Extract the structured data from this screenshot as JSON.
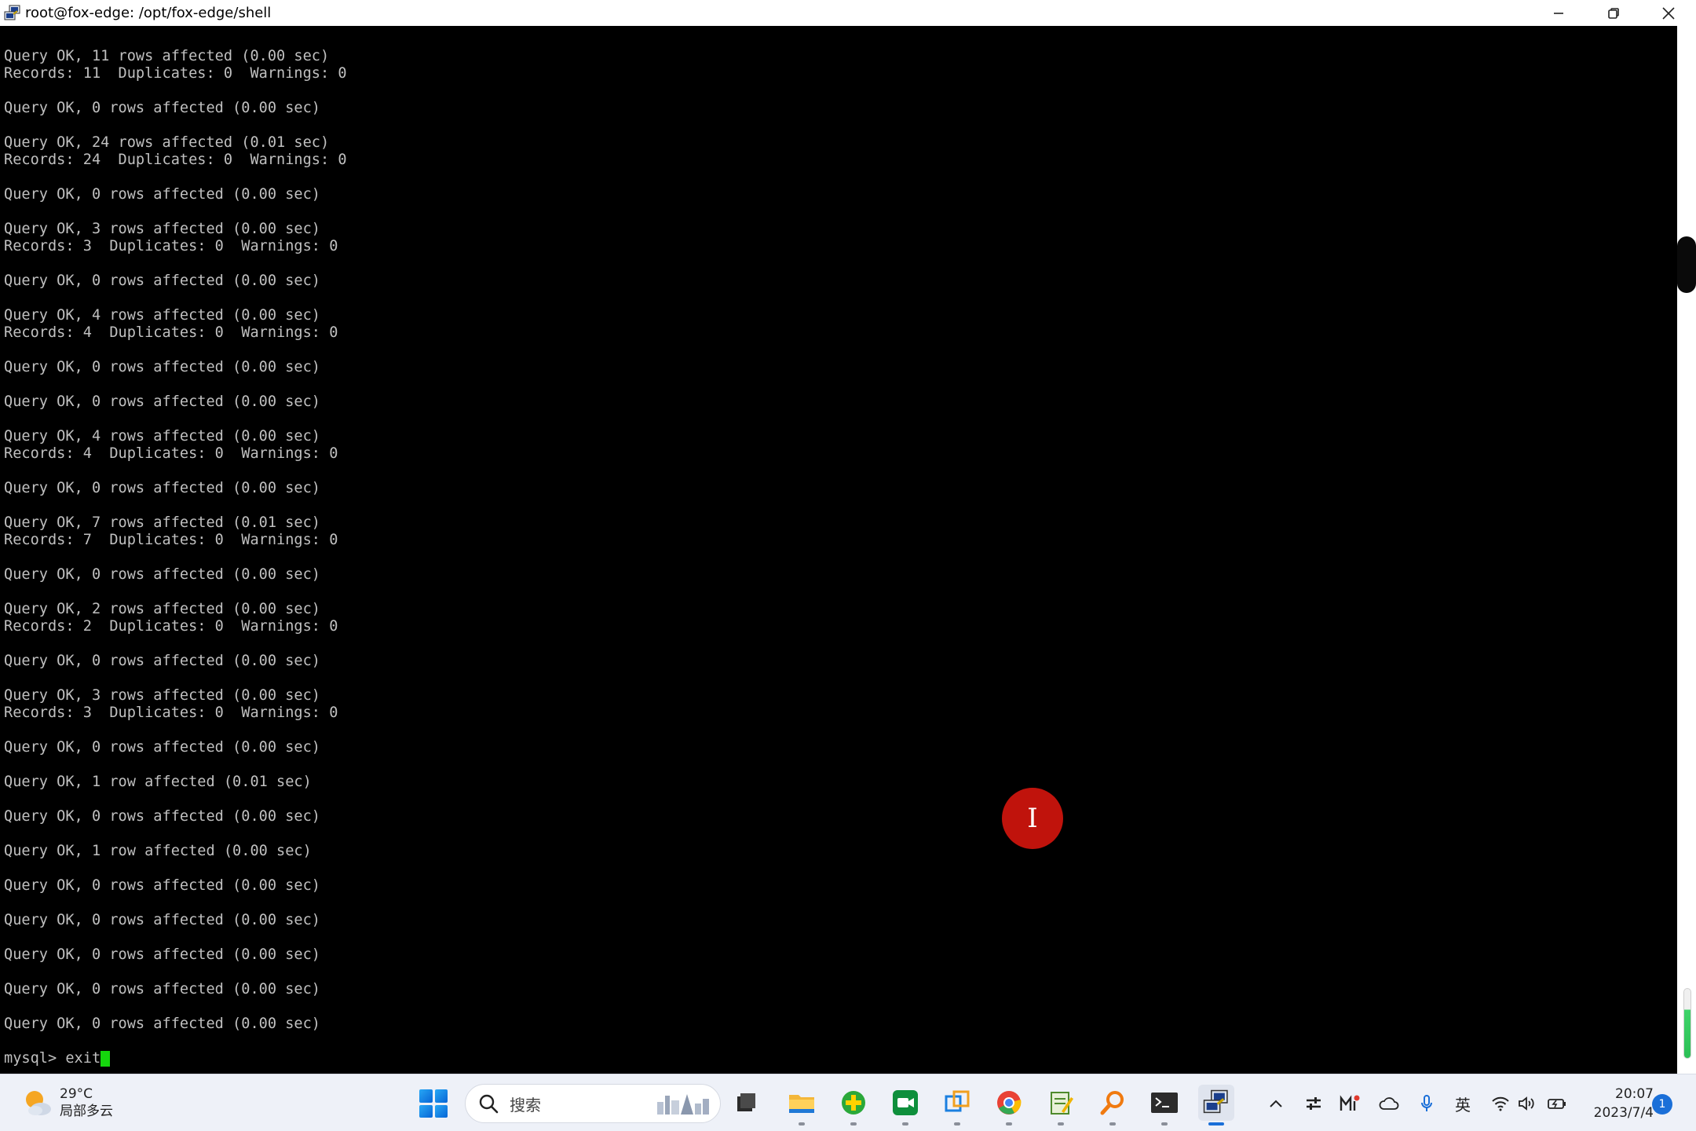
{
  "window": {
    "title": "root@fox-edge: /opt/fox-edge/shell"
  },
  "terminal": {
    "lines": [
      "Query OK, 11 rows affected (0.00 sec)",
      "Records: 11  Duplicates: 0  Warnings: 0",
      "",
      "Query OK, 0 rows affected (0.00 sec)",
      "",
      "Query OK, 24 rows affected (0.01 sec)",
      "Records: 24  Duplicates: 0  Warnings: 0",
      "",
      "Query OK, 0 rows affected (0.00 sec)",
      "",
      "Query OK, 3 rows affected (0.00 sec)",
      "Records: 3  Duplicates: 0  Warnings: 0",
      "",
      "Query OK, 0 rows affected (0.00 sec)",
      "",
      "Query OK, 4 rows affected (0.00 sec)",
      "Records: 4  Duplicates: 0  Warnings: 0",
      "",
      "Query OK, 0 rows affected (0.00 sec)",
      "",
      "Query OK, 0 rows affected (0.00 sec)",
      "",
      "Query OK, 4 rows affected (0.00 sec)",
      "Records: 4  Duplicates: 0  Warnings: 0",
      "",
      "Query OK, 0 rows affected (0.00 sec)",
      "",
      "Query OK, 7 rows affected (0.01 sec)",
      "Records: 7  Duplicates: 0  Warnings: 0",
      "",
      "Query OK, 0 rows affected (0.00 sec)",
      "",
      "Query OK, 2 rows affected (0.00 sec)",
      "Records: 2  Duplicates: 0  Warnings: 0",
      "",
      "Query OK, 0 rows affected (0.00 sec)",
      "",
      "Query OK, 3 rows affected (0.00 sec)",
      "Records: 3  Duplicates: 0  Warnings: 0",
      "",
      "Query OK, 0 rows affected (0.00 sec)",
      "",
      "Query OK, 1 row affected (0.01 sec)",
      "",
      "Query OK, 0 rows affected (0.00 sec)",
      "",
      "Query OK, 1 row affected (0.00 sec)",
      "",
      "Query OK, 0 rows affected (0.00 sec)",
      "",
      "Query OK, 0 rows affected (0.00 sec)",
      "",
      "Query OK, 0 rows affected (0.00 sec)",
      "",
      "Query OK, 0 rows affected (0.00 sec)",
      "",
      "Query OK, 0 rows affected (0.00 sec)",
      ""
    ],
    "prompt": "mysql> exit",
    "cursor_color": "#15d60d"
  },
  "cursor_indicator": {
    "glyph": "I",
    "color": "#c0130c"
  },
  "taskbar": {
    "weather": {
      "temperature": "29°C",
      "condition": "局部多云"
    },
    "search_placeholder": "搜索",
    "apps": [
      "task-view",
      "file-explorer",
      "green-plus-app",
      "video-meeting-app",
      "remote-desktop-app",
      "chrome-browser",
      "notepad-app",
      "search-tool-app",
      "terminal-app",
      "putty-app"
    ],
    "tray": {
      "input_language": "英"
    },
    "clock": {
      "time": "20:07",
      "date": "2023/7/4"
    },
    "notification_count": "1"
  }
}
